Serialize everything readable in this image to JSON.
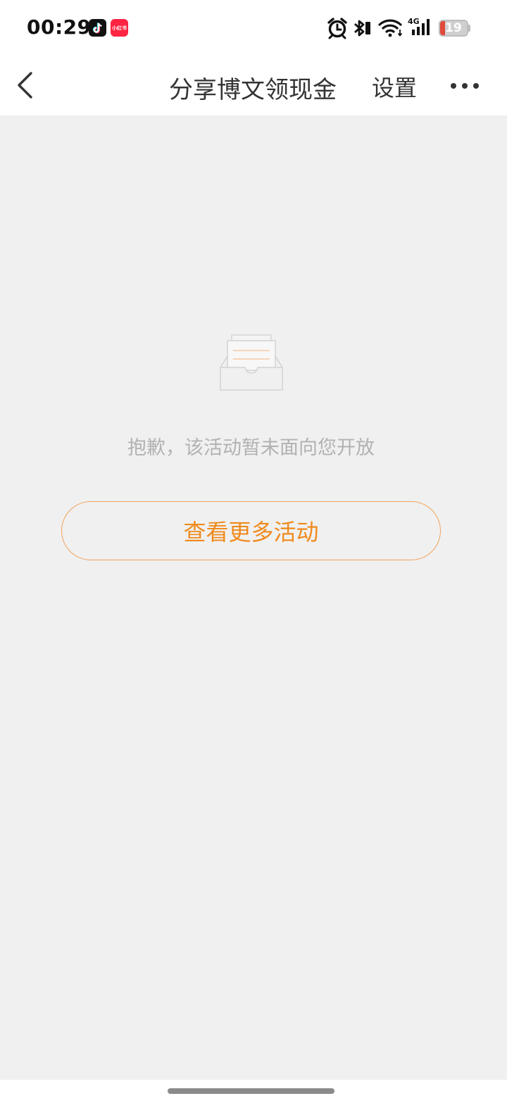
{
  "status_bar": {
    "time": "00:29",
    "apps": [
      "tiktok-icon",
      "xiaohongshu-icon"
    ],
    "xiaohongshu_label": "小红书",
    "icons": [
      "alarm-icon",
      "bluetooth-icon",
      "wifi-icon",
      "signal-4g-icon",
      "battery-icon"
    ],
    "network_label": "4G",
    "battery_level": "19",
    "battery_fraction": 0.19
  },
  "nav": {
    "title": "分享博文领现金",
    "settings_label": "设置",
    "back_icon": "chevron-left-icon",
    "more_icon": "more-dots-icon"
  },
  "empty_state": {
    "icon": "empty-inbox-icon",
    "message": "抱歉，该活动暂未面向您开放",
    "button_label": "查看更多活动"
  },
  "colors": {
    "accent": "#f08a1c",
    "button_border": "#f0a35a",
    "background": "#f0f0f0",
    "message_text": "#b2b2b2",
    "title_text": "#333333",
    "battery_low": "#e04a3a"
  }
}
